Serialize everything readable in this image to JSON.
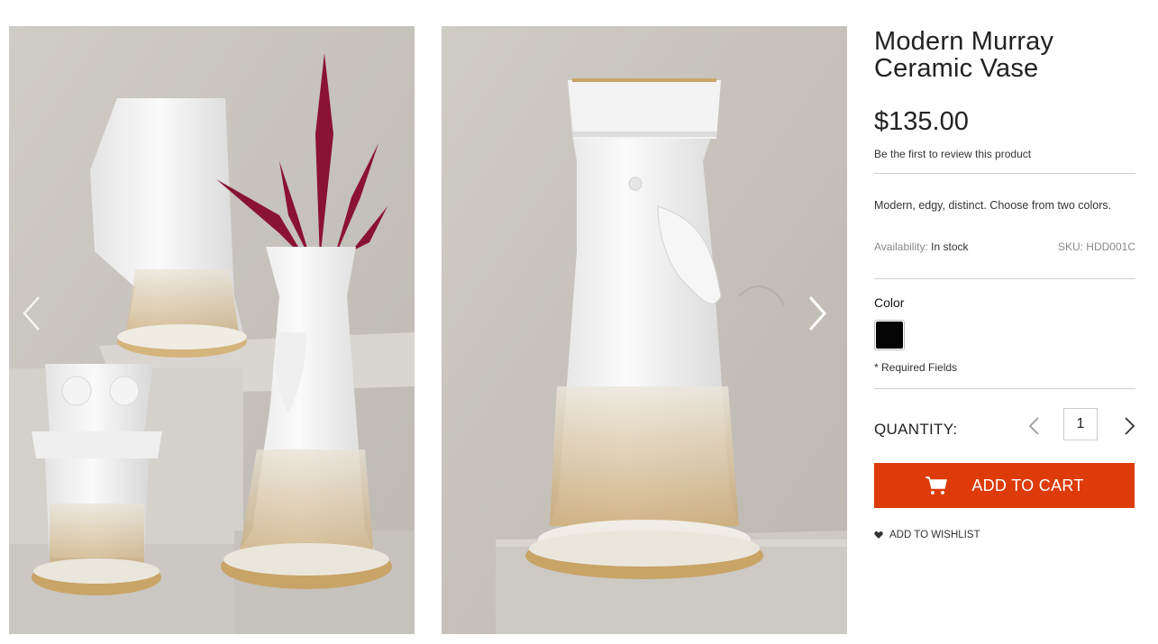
{
  "product": {
    "title_line1": "Modern Murray",
    "title_line2": "Ceramic Vase",
    "price": "$135.00",
    "review_link": "Be the first to review this product",
    "description": "Modern, edgy, distinct. Choose from two colors.",
    "availability_label": "Availability:",
    "availability_value": "In stock",
    "sku": "SKU: HDD001C"
  },
  "options": {
    "color_label": "Color",
    "swatch_color": "#050505",
    "required_note": "* Required Fields"
  },
  "quantity": {
    "label": "QUANTITY:",
    "value": "1"
  },
  "actions": {
    "add_to_cart": "ADD TO CART",
    "add_to_wishlist": "ADD TO WISHLIST"
  },
  "theme": {
    "accent": "#dd3b0a"
  },
  "icons": {
    "prev": "chevron-left-icon",
    "next": "chevron-right-icon",
    "cart": "cart-icon",
    "wishlist": "heart-icon",
    "qty_minus": "chevron-left-icon",
    "qty_plus": "chevron-right-icon"
  }
}
